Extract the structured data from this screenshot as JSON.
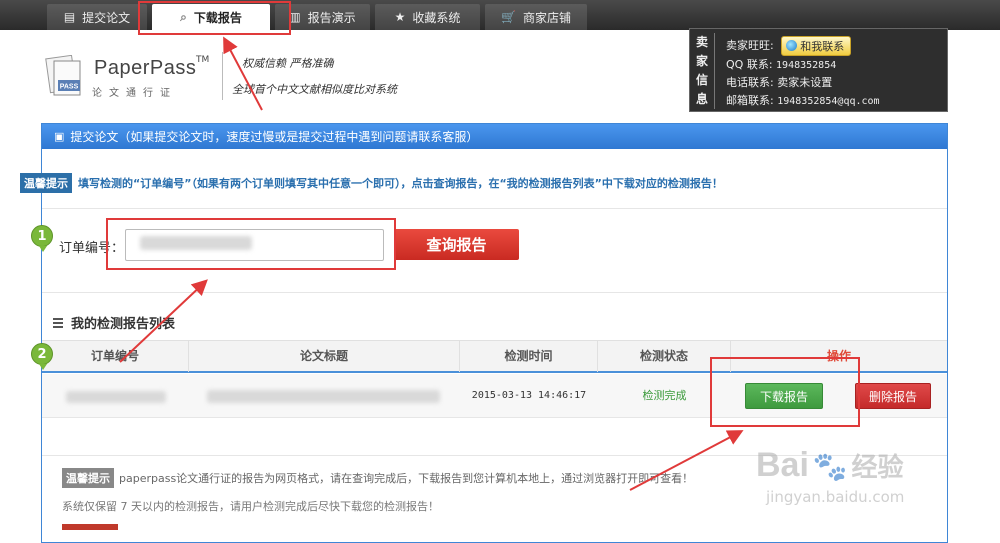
{
  "nav": {
    "tabs": [
      {
        "label": "提交论文",
        "icon": "document-icon"
      },
      {
        "label": "下载报告",
        "icon": "search-icon"
      },
      {
        "label": "报告演示",
        "icon": "bar-chart-icon"
      },
      {
        "label": "收藏系统",
        "icon": "star-icon"
      },
      {
        "label": "商家店铺",
        "icon": "cart-icon"
      }
    ]
  },
  "seller": {
    "header_chars": [
      "卖",
      "家",
      "信",
      "息"
    ],
    "wangwang_label": "卖家旺旺:",
    "wangwang_button": "和我联系",
    "qq_label": "QQ 联系:",
    "qq_value": "1948352854",
    "phone_label": "电话联系:",
    "phone_value": "卖家未设置",
    "email_label": "邮箱联系:",
    "email_value": "1948352854@qq.com"
  },
  "logo": {
    "name": "PaperPass",
    "tm": "TM",
    "subtitle": "论文通行证",
    "badge": "PASS",
    "slogan_line1": "权威信赖  严格准确",
    "slogan_line2": "全球首个中文文献相似度比对系统"
  },
  "panel": {
    "header": "提交论文（如果提交论文时，速度过慢或是提交过程中遇到问题请联系客服）",
    "tip_badge": "温馨提示",
    "tip_text": "填写检测的“订单编号”（如果有两个订单则填写其中任意一个即可），点击查询报告，在“我的检测报告列表”中下载对应的检测报告！",
    "order_label": "订单编号：",
    "query_button": "查询报告",
    "list_title": "我的检测报告列表",
    "columns": [
      "订单编号",
      "论文标题",
      "检测时间",
      "检测状态",
      "操作"
    ],
    "rows": [
      {
        "time": "2015-03-13 14:46:17",
        "status": "检测完成",
        "download": "下载报告",
        "delete": "删除报告"
      }
    ],
    "note_badge": "温馨提示",
    "note1": "paperpass论文通行证的报告为网页格式，请在查询完成后，下载报告到您计算机本地上，通过浏览器打开即可查看！",
    "note2": "系统仅保留 7 天以内的检测报告，请用户检测完成后尽快下载您的检测报告！"
  },
  "annotations": {
    "step1": "1",
    "step2": "2"
  },
  "watermark": {
    "main": "Bai",
    "cn": "经验",
    "sub": "jingyan.baidu.com"
  },
  "colors": {
    "accent_blue": "#3f86d6",
    "danger_red": "#d93a33",
    "success_green": "#4aa84a",
    "annotation_red": "#e03a3a",
    "step_green": "#7ab83a"
  }
}
